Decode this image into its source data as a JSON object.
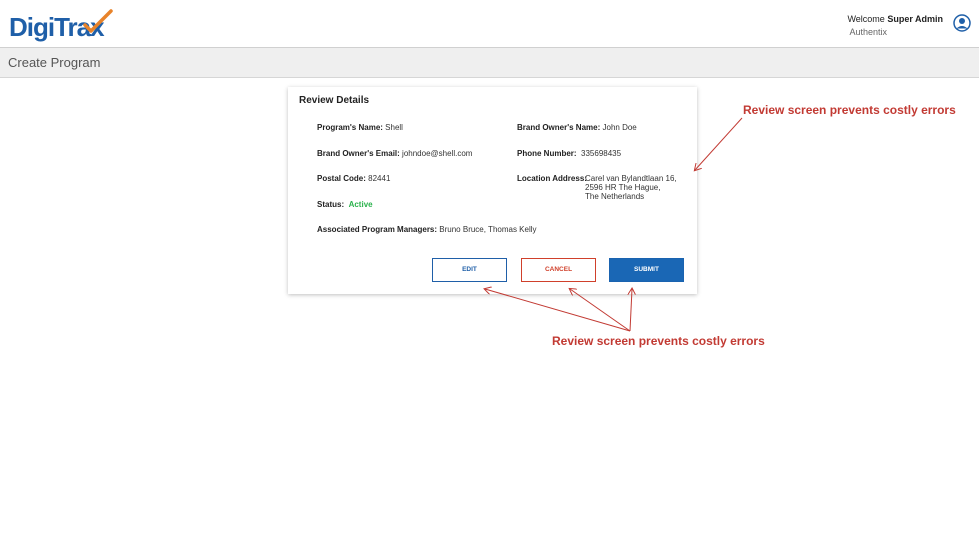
{
  "header": {
    "logo_text": "DigiTrax",
    "welcome": "Welcome",
    "user_name": "Super Admin",
    "org": "Authentix"
  },
  "page": {
    "title": "Create Program"
  },
  "review": {
    "title": "Review Details",
    "program_name_label": "Program's Name:",
    "program_name": "Shell",
    "brand_owner_name_label": "Brand Owner's  Name:",
    "brand_owner_name": "John Doe",
    "brand_owner_email_label": "Brand Owner's Email:",
    "brand_owner_email": "johndoe@shell.com",
    "phone_label": "Phone Number:",
    "phone": "335698435",
    "postal_label": "Postal Code:",
    "postal": "82441",
    "location_label": "Location Address:",
    "location_line1": "Carel van Bylandtlaan 16,",
    "location_line2": "2596 HR The Hague,",
    "location_line3": "The Netherlands",
    "status_label": "Status:",
    "status": "Active",
    "managers_label": "Associated Program Managers:",
    "managers": "Bruno Bruce, Thomas Kelly"
  },
  "buttons": {
    "edit": "EDIT",
    "cancel": "CANCEL",
    "submit": "SUBMIT"
  },
  "annotations": {
    "top": "Review screen prevents costly errors",
    "bottom": "Review screen prevents costly errors"
  },
  "colors": {
    "brand_blue": "#1f5fa8",
    "cancel_red": "#d0402b",
    "status_green": "#2bb24c",
    "annotation_red": "#c23a33"
  }
}
